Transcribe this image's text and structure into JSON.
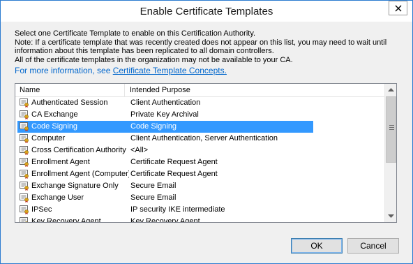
{
  "window": {
    "title": "Enable Certificate Templates"
  },
  "description": {
    "line1": "Select one Certificate Template to enable on this Certification Authority.",
    "line2": "Note: If a certificate template that was recently created does not appear on this list, you may need to wait until",
    "line3": "information about this template has been replicated to all domain controllers.",
    "line4": "All of the certificate templates in the organization may not be available to your CA.",
    "more_info_prefix": "For more information, see ",
    "more_info_link": "Certificate Template Concepts."
  },
  "list": {
    "columns": {
      "name": "Name",
      "purpose": "Intended Purpose"
    },
    "rows": [
      {
        "name": "Authenticated Session",
        "purpose": "Client Authentication"
      },
      {
        "name": "CA Exchange",
        "purpose": "Private Key Archival"
      },
      {
        "name": "Code Signing",
        "purpose": "Code Signing",
        "selected": true
      },
      {
        "name": "Computer",
        "purpose": "Client Authentication, Server Authentication"
      },
      {
        "name": "Cross Certification Authority",
        "purpose": "<All>"
      },
      {
        "name": "Enrollment Agent",
        "purpose": "Certificate Request Agent"
      },
      {
        "name": "Enrollment Agent (Computer)",
        "purpose": "Certificate Request Agent"
      },
      {
        "name": "Exchange Signature Only",
        "purpose": "Secure Email"
      },
      {
        "name": "Exchange User",
        "purpose": "Secure Email"
      },
      {
        "name": "IPSec",
        "purpose": "IP security IKE intermediate"
      },
      {
        "name": "Key Recovery Agent",
        "purpose": "Key Recovery Agent"
      }
    ],
    "row_icon": "certificate-template-icon",
    "scroll_fraction": 0.0
  },
  "buttons": {
    "ok": "OK",
    "cancel": "Cancel"
  },
  "colors": {
    "selection": "#3399ff",
    "link": "#0066cc",
    "border_accent": "#2b7bd0"
  }
}
